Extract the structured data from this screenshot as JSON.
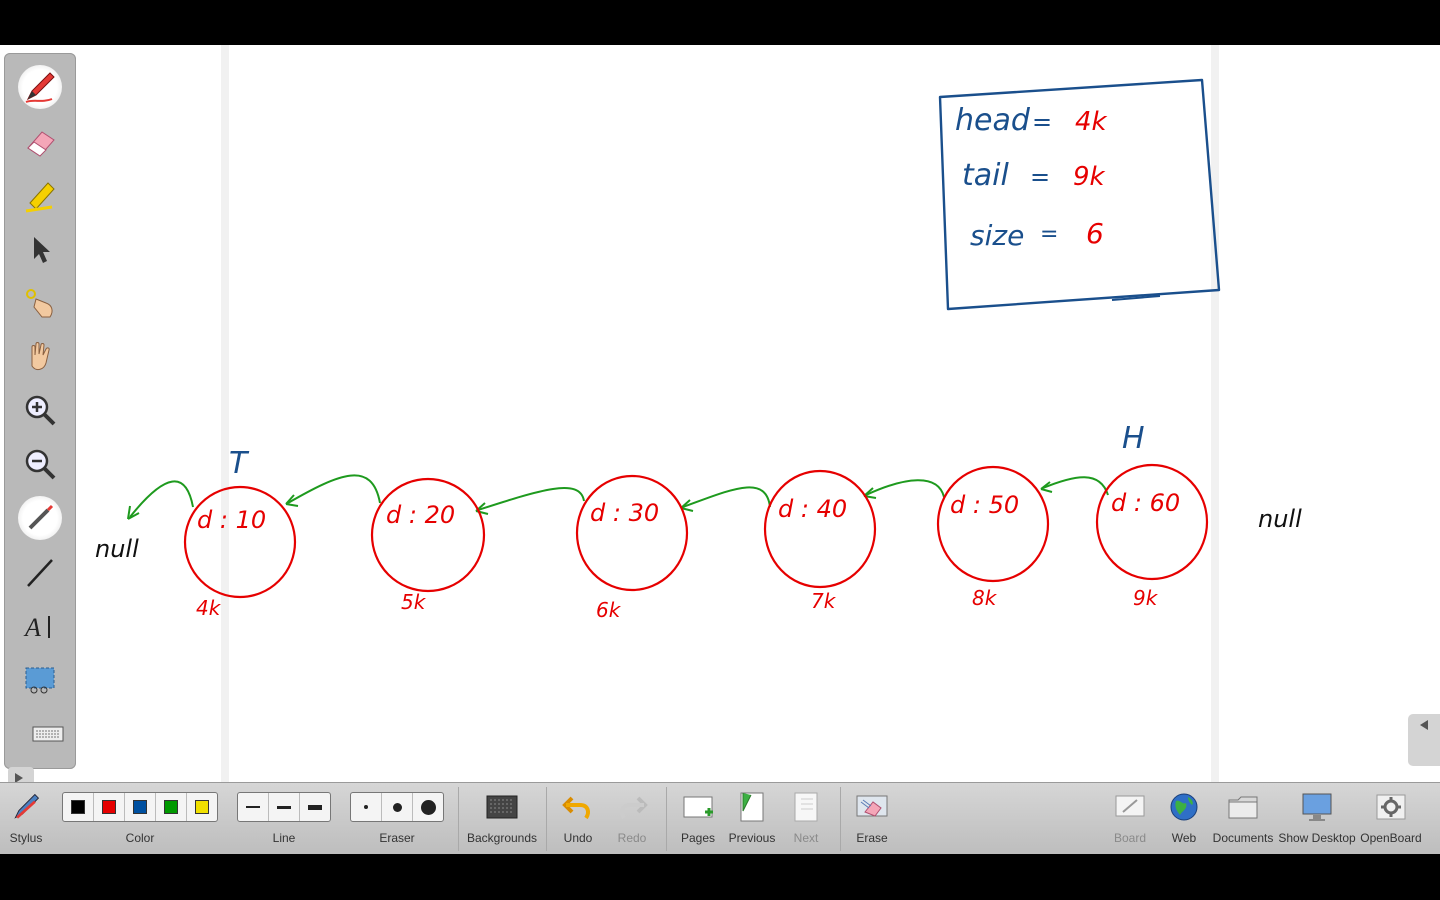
{
  "board": {
    "info_box": {
      "rows": [
        {
          "label": "head",
          "eq": "=",
          "value": "4k"
        },
        {
          "label": "tail",
          "eq": "=",
          "value": "9k"
        },
        {
          "label": "size",
          "eq": "=",
          "value": "6"
        }
      ]
    },
    "marker_tail": "T",
    "marker_head": "H",
    "null_left": "null",
    "null_right": "null",
    "nodes": [
      {
        "data": "d : 10",
        "addr": "4k"
      },
      {
        "data": "d : 20",
        "addr": "5k"
      },
      {
        "data": "d : 30",
        "addr": "6k"
      },
      {
        "data": "d : 40",
        "addr": "7k"
      },
      {
        "data": "d : 50",
        "addr": "8k"
      },
      {
        "data": "d : 60",
        "addr": "9k"
      }
    ]
  },
  "palette": {
    "tools": [
      "pen-icon",
      "eraser-icon",
      "highlighter-icon",
      "selector-icon",
      "interactor-icon",
      "hand-icon",
      "zoom-in-icon",
      "zoom-out-icon",
      "laser-pointer-icon",
      "line-icon",
      "text-icon",
      "capture-icon",
      "keyboard-icon"
    ]
  },
  "toolbar": {
    "stylus": "Stylus",
    "color": "Color",
    "colors": [
      "#000000",
      "#e60000",
      "#0050a0",
      "#009900",
      "#f0e000"
    ],
    "line": "Line",
    "eraser": "Eraser",
    "backgrounds": "Backgrounds",
    "undo": "Undo",
    "redo": "Redo",
    "pages": "Pages",
    "previous": "Previous",
    "next": "Next",
    "erase": "Erase",
    "board": "Board",
    "web": "Web",
    "documents": "Documents",
    "show_desktop": "Show Desktop",
    "openboard": "OpenBoard"
  }
}
